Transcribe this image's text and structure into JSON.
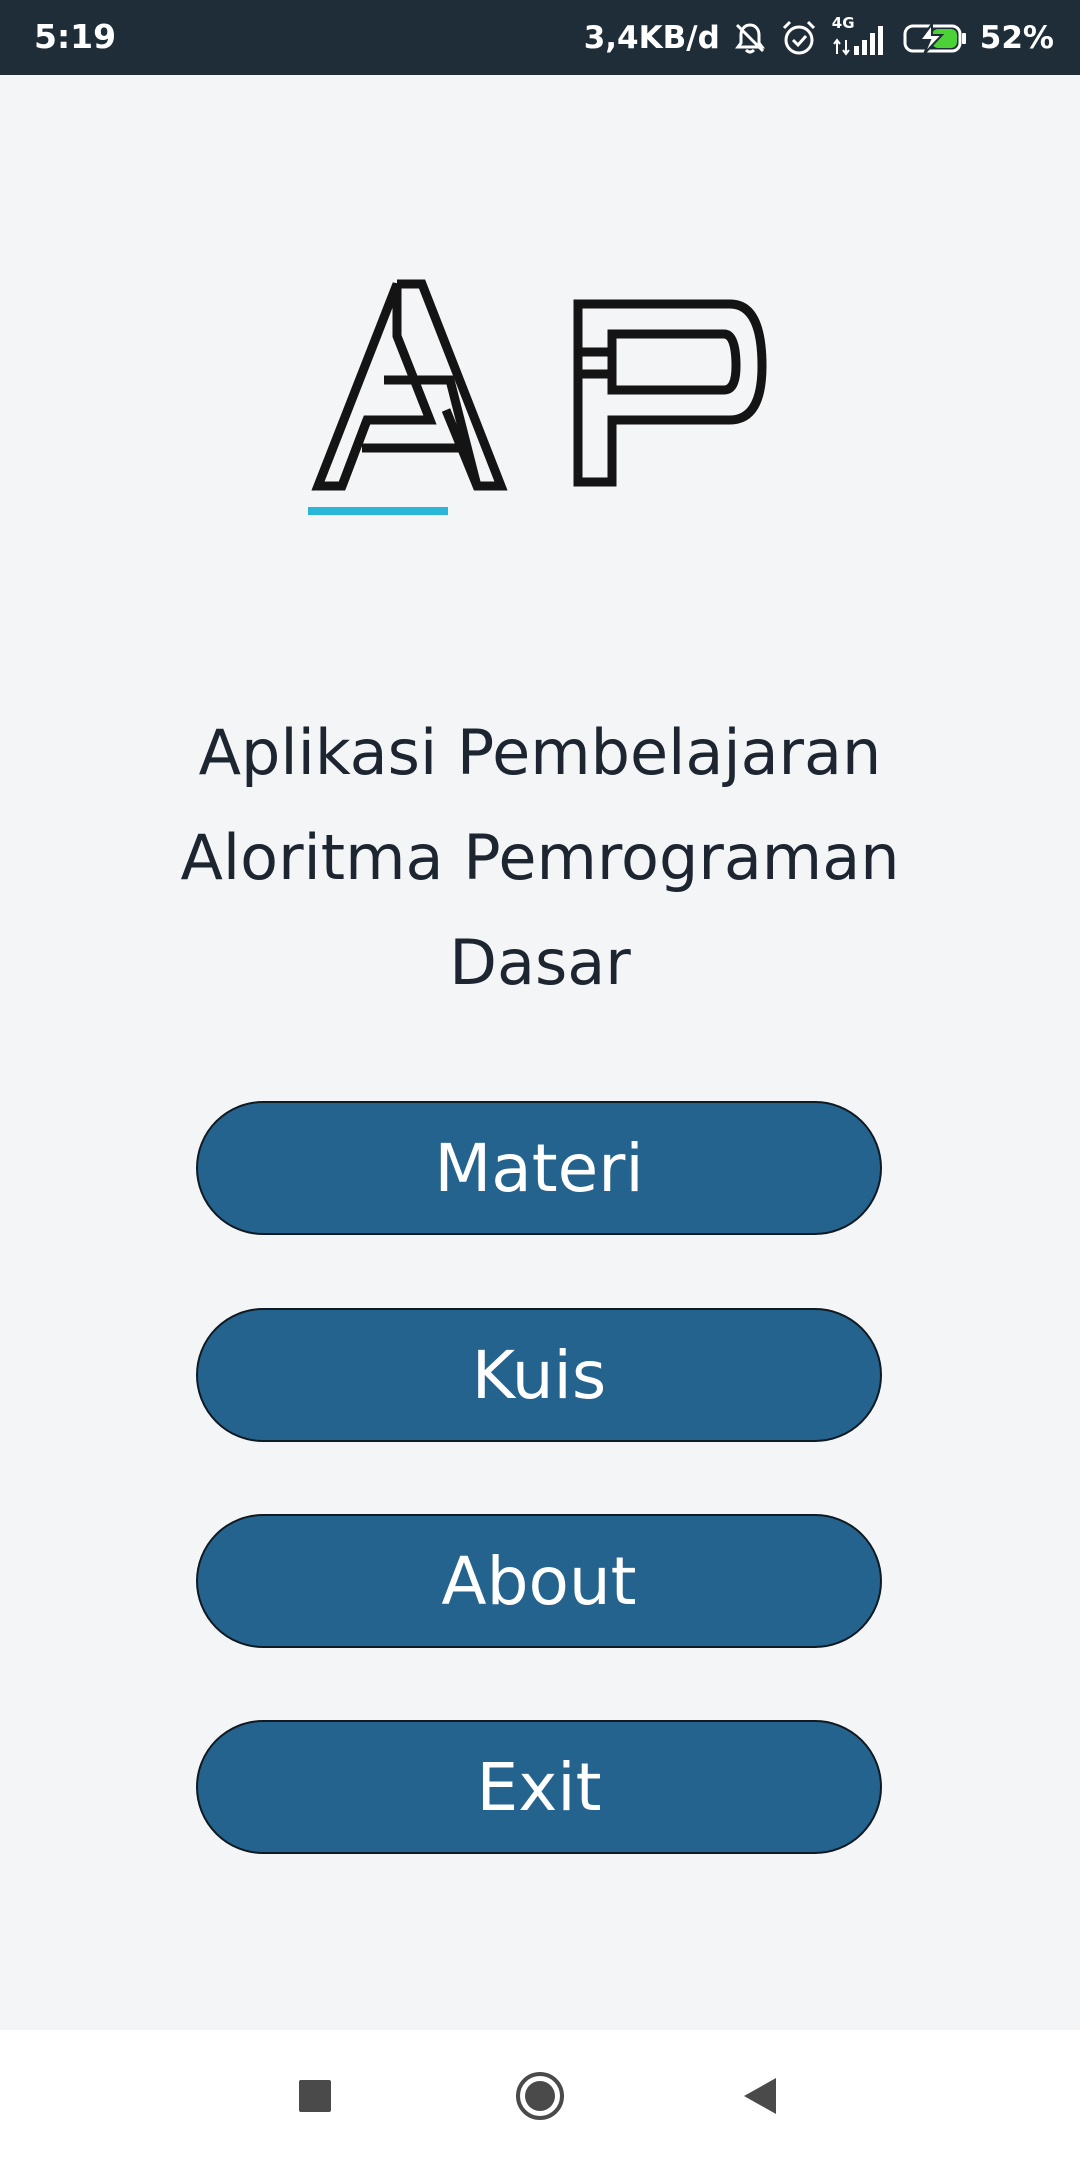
{
  "status_bar": {
    "time": "5:19",
    "network_speed": "3,4KB/d",
    "network_type": "4G",
    "battery_percent": "52%",
    "icons": [
      "notifications-off-icon",
      "alarm-icon",
      "signal-icon",
      "battery-charging-icon"
    ],
    "colors": {
      "background": "#1f2d38",
      "battery_fill": "#4cd137"
    }
  },
  "logo": {
    "letters": "AP",
    "accent_color": "#29b6d9"
  },
  "title": {
    "line1": "Aplikasi Pembelajaran",
    "line2": "Aloritma Pemrograman",
    "line3": "Dasar"
  },
  "menu": {
    "buttons": [
      {
        "label": "Materi"
      },
      {
        "label": "Kuis"
      },
      {
        "label": "About"
      },
      {
        "label": "Exit"
      }
    ],
    "button_color": "#24638e"
  },
  "nav_bar": {
    "buttons": [
      "recents-square-icon",
      "home-circle-icon",
      "back-triangle-icon"
    ]
  }
}
